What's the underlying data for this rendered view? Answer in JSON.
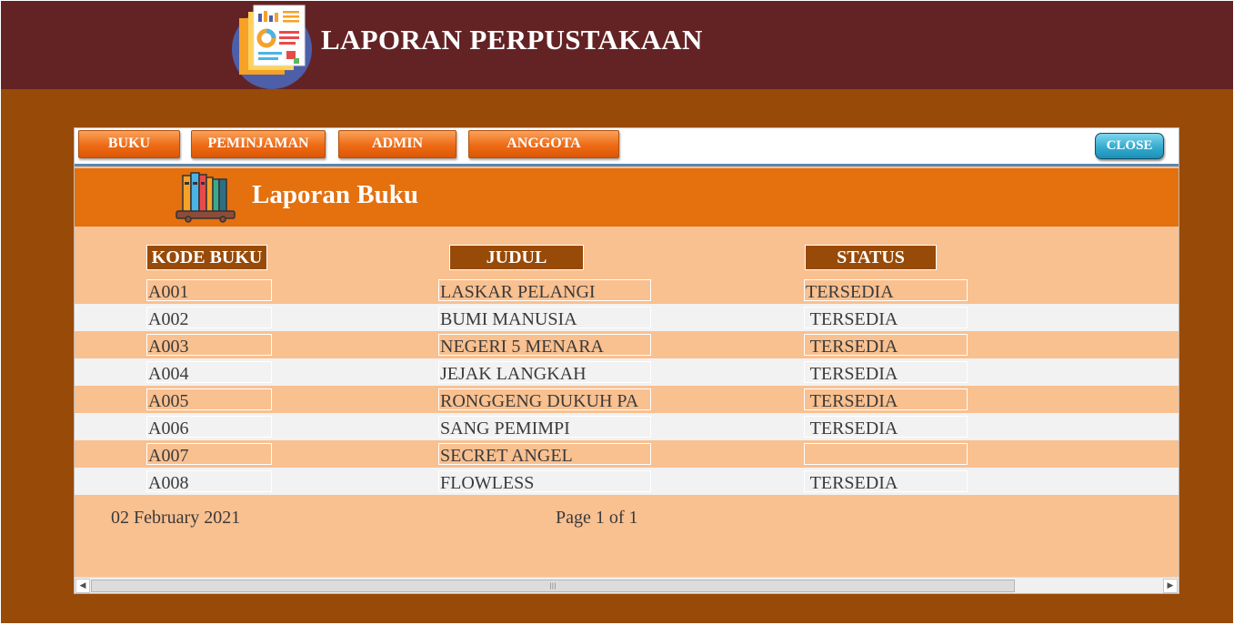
{
  "app": {
    "title": "LAPORAN PERPUSTAKAAN",
    "logo_icon": "report-document-icon"
  },
  "menu": {
    "buttons": [
      "BUKU",
      "PEMINJAMAN",
      "ADMIN",
      "ANGGOTA"
    ],
    "close_label": "CLOSE"
  },
  "report": {
    "title": "Laporan Buku",
    "icon": "bookshelf-icon",
    "columns": [
      "KODE BUKU",
      "JUDUL",
      "STATUS"
    ],
    "rows": [
      {
        "kode": "A001",
        "judul": "LASKAR PELANGI",
        "status": "TERSEDIA"
      },
      {
        "kode": "A002",
        "judul": "BUMI MANUSIA",
        "status": " TERSEDIA"
      },
      {
        "kode": "A003",
        "judul": "NEGERI 5 MENARA",
        "status": " TERSEDIA"
      },
      {
        "kode": "A004",
        "judul": "JEJAK LANGKAH",
        "status": " TERSEDIA"
      },
      {
        "kode": "A005",
        "judul": "RONGGENG DUKUH PA",
        "status": " TERSEDIA"
      },
      {
        "kode": "A006",
        "judul": "SANG PEMIMPI",
        "status": " TERSEDIA"
      },
      {
        "kode": "A007",
        "judul": "SECRET ANGEL",
        "status": ""
      },
      {
        "kode": "A008",
        "judul": "FLOWLESS",
        "status": " TERSEDIA"
      }
    ],
    "date": "02 February 2021",
    "page_info": "Page 1 of 1"
  },
  "colors": {
    "title_bar": "#632325",
    "background": "#984a08",
    "header_orange": "#e4700e",
    "row_peach": "#f9c090",
    "row_gray": "#f2f2f2",
    "close_button": "#34abd0"
  }
}
